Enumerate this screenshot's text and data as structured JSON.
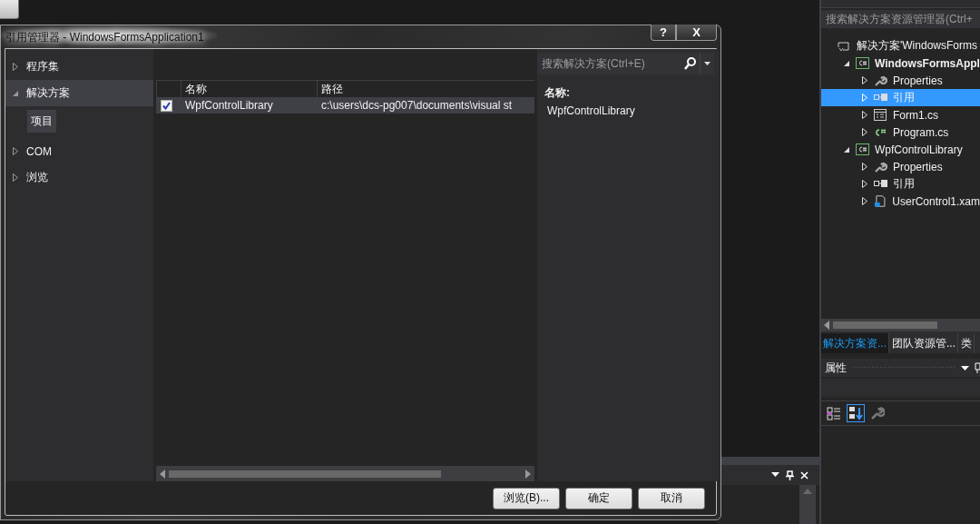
{
  "dialog": {
    "title": "引用管理器 - WindowsFormsApplication1",
    "title_buttons": [
      {
        "label": "?",
        "kind": "help"
      },
      {
        "label": "X",
        "kind": "close"
      }
    ],
    "nav": [
      {
        "label": "程序集",
        "expanded": false,
        "selected": false
      },
      {
        "label": "解决方案",
        "expanded": true,
        "selected": true,
        "children": [
          {
            "label": "项目",
            "selected": true
          }
        ]
      },
      {
        "label": "COM",
        "expanded": false,
        "selected": false
      },
      {
        "label": "浏览",
        "expanded": false,
        "selected": false
      }
    ],
    "search": {
      "placeholder": "搜索解决方案(Ctrl+E)"
    },
    "table": {
      "columns": [
        "名称",
        "路径"
      ],
      "rows": [
        {
          "checked": true,
          "selected": true,
          "cells": [
            "WpfControlLibrary",
            "c:\\users\\dcs-pg007\\documents\\visual st"
          ]
        }
      ]
    },
    "details": {
      "label": "名称:",
      "value": "WpfControlLibrary"
    },
    "buttons": [
      "浏览(B)...",
      "确定",
      "取消"
    ]
  },
  "solution_explorer": {
    "search": {
      "placeholder": "搜索解决方案资源管理器(Ctrl+"
    },
    "tree": [
      {
        "label": "解决方案'WindowsForms",
        "kind": "solution",
        "selected": false,
        "children": [
          {
            "label": "WindowsFormsAppl",
            "kind": "project",
            "bold": true,
            "expanded": true,
            "selected": false,
            "children": [
              {
                "label": "Properties",
                "kind": "properties",
                "expanded": false,
                "selected": false
              },
              {
                "label": "引用",
                "kind": "references",
                "expanded": false,
                "selected": true
              },
              {
                "label": "Form1.cs",
                "kind": "form",
                "expanded": false,
                "selected": false
              },
              {
                "label": "Program.cs",
                "kind": "csharp",
                "expanded": false,
                "selected": false
              }
            ]
          },
          {
            "label": "WpfControlLibrary",
            "kind": "project",
            "bold": false,
            "expanded": true,
            "selected": false,
            "children": [
              {
                "label": "Properties",
                "kind": "properties",
                "expanded": false,
                "selected": false
              },
              {
                "label": "引用",
                "kind": "references",
                "expanded": false,
                "selected": false
              },
              {
                "label": "UserControl1.xam",
                "kind": "xaml",
                "expanded": false,
                "selected": false
              }
            ]
          }
        ]
      }
    ],
    "tabs": [
      {
        "label": "解决方案资...",
        "selected": true
      },
      {
        "label": "团队资源管...",
        "selected": false
      },
      {
        "label": "类",
        "selected": false
      }
    ],
    "properties": {
      "title": "属性"
    }
  }
}
